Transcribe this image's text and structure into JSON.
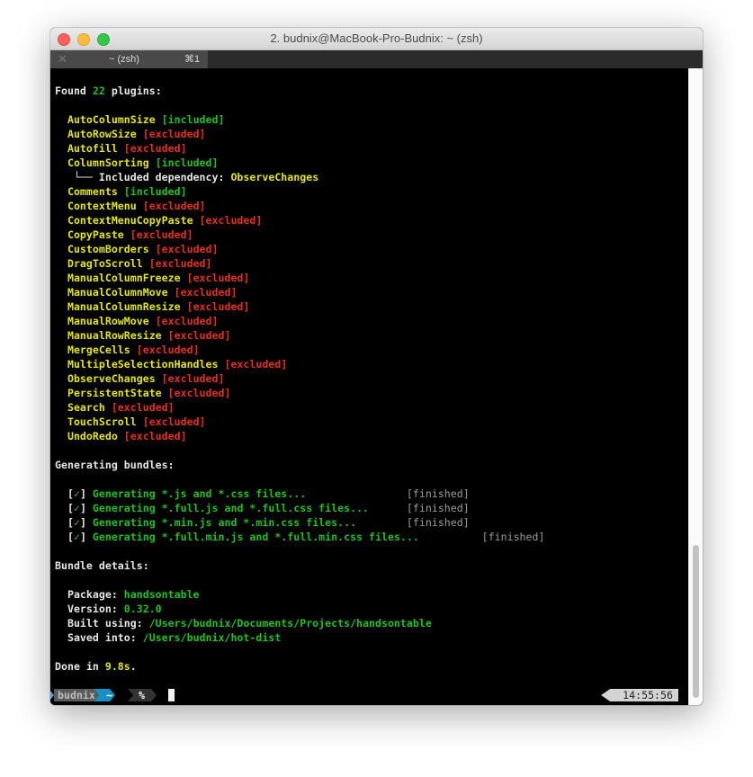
{
  "window": {
    "title": "2. budnix@MacBook-Pro-Budnix: ~ (zsh)"
  },
  "tab": {
    "close": "✕",
    "label": "~ (zsh)",
    "shortcut": "⌘1"
  },
  "colors": {
    "white": "#e6e6e6",
    "yellow": "#e5e510",
    "green": "#1fc21f",
    "red": "#e3311f",
    "gray": "#9a9a9a",
    "blue": "#1a8fc0"
  },
  "terminal": {
    "lines": [
      [
        {
          "t": "Found ",
          "c": "white"
        },
        {
          "t": "22",
          "c": "green"
        },
        {
          "t": " plugins:",
          "c": "white"
        }
      ],
      [],
      [
        {
          "t": "  AutoColumnSize ",
          "c": "yellow"
        },
        {
          "t": "[included]",
          "c": "green"
        }
      ],
      [
        {
          "t": "  AutoRowSize ",
          "c": "yellow"
        },
        {
          "t": "[excluded]",
          "c": "red"
        }
      ],
      [
        {
          "t": "  Autofill ",
          "c": "yellow"
        },
        {
          "t": "[excluded]",
          "c": "red"
        }
      ],
      [
        {
          "t": "  ColumnSorting ",
          "c": "yellow"
        },
        {
          "t": "[included]",
          "c": "green"
        }
      ],
      [
        {
          "t": "   └── Included dependency: ",
          "c": "white"
        },
        {
          "t": "ObserveChanges",
          "c": "yellow"
        }
      ],
      [
        {
          "t": "  Comments ",
          "c": "yellow"
        },
        {
          "t": "[included]",
          "c": "green"
        }
      ],
      [
        {
          "t": "  ContextMenu ",
          "c": "yellow"
        },
        {
          "t": "[excluded]",
          "c": "red"
        }
      ],
      [
        {
          "t": "  ContextMenuCopyPaste ",
          "c": "yellow"
        },
        {
          "t": "[excluded]",
          "c": "red"
        }
      ],
      [
        {
          "t": "  CopyPaste ",
          "c": "yellow"
        },
        {
          "t": "[excluded]",
          "c": "red"
        }
      ],
      [
        {
          "t": "  CustomBorders ",
          "c": "yellow"
        },
        {
          "t": "[excluded]",
          "c": "red"
        }
      ],
      [
        {
          "t": "  DragToScroll ",
          "c": "yellow"
        },
        {
          "t": "[excluded]",
          "c": "red"
        }
      ],
      [
        {
          "t": "  ManualColumnFreeze ",
          "c": "yellow"
        },
        {
          "t": "[excluded]",
          "c": "red"
        }
      ],
      [
        {
          "t": "  ManualColumnMove ",
          "c": "yellow"
        },
        {
          "t": "[excluded]",
          "c": "red"
        }
      ],
      [
        {
          "t": "  ManualColumnResize ",
          "c": "yellow"
        },
        {
          "t": "[excluded]",
          "c": "red"
        }
      ],
      [
        {
          "t": "  ManualRowMove ",
          "c": "yellow"
        },
        {
          "t": "[excluded]",
          "c": "red"
        }
      ],
      [
        {
          "t": "  ManualRowResize ",
          "c": "yellow"
        },
        {
          "t": "[excluded]",
          "c": "red"
        }
      ],
      [
        {
          "t": "  MergeCells ",
          "c": "yellow"
        },
        {
          "t": "[excluded]",
          "c": "red"
        }
      ],
      [
        {
          "t": "  MultipleSelectionHandles ",
          "c": "yellow"
        },
        {
          "t": "[excluded]",
          "c": "red"
        }
      ],
      [
        {
          "t": "  ObserveChanges ",
          "c": "yellow"
        },
        {
          "t": "[excluded]",
          "c": "red"
        }
      ],
      [
        {
          "t": "  PersistentState ",
          "c": "yellow"
        },
        {
          "t": "[excluded]",
          "c": "red"
        }
      ],
      [
        {
          "t": "  Search ",
          "c": "yellow"
        },
        {
          "t": "[excluded]",
          "c": "red"
        }
      ],
      [
        {
          "t": "  TouchScroll ",
          "c": "yellow"
        },
        {
          "t": "[excluded]",
          "c": "red"
        }
      ],
      [
        {
          "t": "  UndoRedo ",
          "c": "yellow"
        },
        {
          "t": "[excluded]",
          "c": "red"
        }
      ],
      [],
      [
        {
          "t": "Generating bundles:",
          "c": "white"
        }
      ],
      [],
      [
        {
          "t": "  [",
          "c": "white"
        },
        {
          "t": "✓",
          "c": "green"
        },
        {
          "t": "] ",
          "c": "white"
        },
        {
          "t": "Generating *.js and *.css files...                ",
          "c": "green"
        },
        {
          "t": "[finished]",
          "c": "gray"
        }
      ],
      [
        {
          "t": "  [",
          "c": "white"
        },
        {
          "t": "✓",
          "c": "green"
        },
        {
          "t": "] ",
          "c": "white"
        },
        {
          "t": "Generating *.full.js and *.full.css files...      ",
          "c": "green"
        },
        {
          "t": "[finished]",
          "c": "gray"
        }
      ],
      [
        {
          "t": "  [",
          "c": "white"
        },
        {
          "t": "✓",
          "c": "green"
        },
        {
          "t": "] ",
          "c": "white"
        },
        {
          "t": "Generating *.min.js and *.min.css files...        ",
          "c": "green"
        },
        {
          "t": "[finished]",
          "c": "gray"
        }
      ],
      [
        {
          "t": "  [",
          "c": "white"
        },
        {
          "t": "✓",
          "c": "green"
        },
        {
          "t": "] ",
          "c": "white"
        },
        {
          "t": "Generating *.full.min.js and *.full.min.css files...",
          "c": "green"
        },
        {
          "t": "          [finished]",
          "c": "gray"
        }
      ],
      [],
      [
        {
          "t": "Bundle details:",
          "c": "white"
        }
      ],
      [],
      [
        {
          "t": "  Package: ",
          "c": "white"
        },
        {
          "t": "handsontable",
          "c": "green"
        }
      ],
      [
        {
          "t": "  Version: ",
          "c": "white"
        },
        {
          "t": "0.32.0",
          "c": "green"
        }
      ],
      [
        {
          "t": "  Built using: ",
          "c": "white"
        },
        {
          "t": "/Users/budnix/Documents/Projects/handsontable",
          "c": "green"
        }
      ],
      [
        {
          "t": "  Saved into: ",
          "c": "white"
        },
        {
          "t": "/Users/budnix/hot-dist",
          "c": "green"
        }
      ],
      [],
      [
        {
          "t": "Done in ",
          "c": "white"
        },
        {
          "t": "9.8s",
          "c": "yellow"
        },
        {
          "t": ".",
          "c": "white"
        }
      ]
    ]
  },
  "prompt": {
    "user": "budnix",
    "dir": "~",
    "symbol": "%",
    "time": "14:55:56"
  }
}
